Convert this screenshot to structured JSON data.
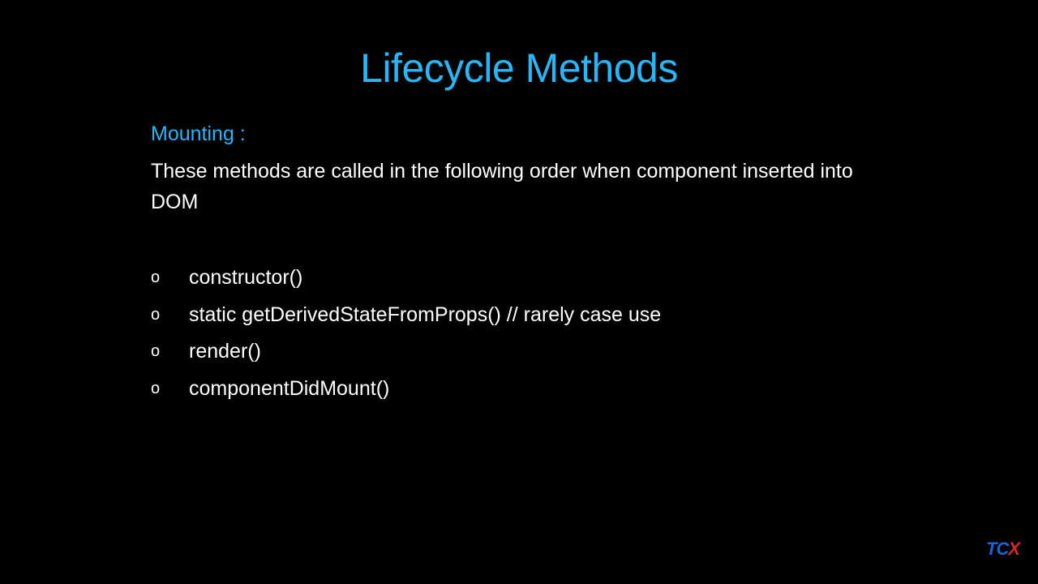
{
  "slide": {
    "title": "Lifecycle Methods",
    "section_heading": "Mounting :",
    "description": "These methods are called in the following order when component inserted into DOM",
    "bullet_glyph": "o",
    "methods": [
      "constructor()",
      "static getDerivedStateFromProps()  // rarely case use",
      "render()",
      "componentDidMount()"
    ],
    "logo": {
      "tc": "TC",
      "x": "X"
    }
  },
  "colors": {
    "background": "#000000",
    "accent": "#29b6f6",
    "text": "#ffffff",
    "logo_blue": "#1e63d6",
    "logo_red": "#d62828"
  }
}
